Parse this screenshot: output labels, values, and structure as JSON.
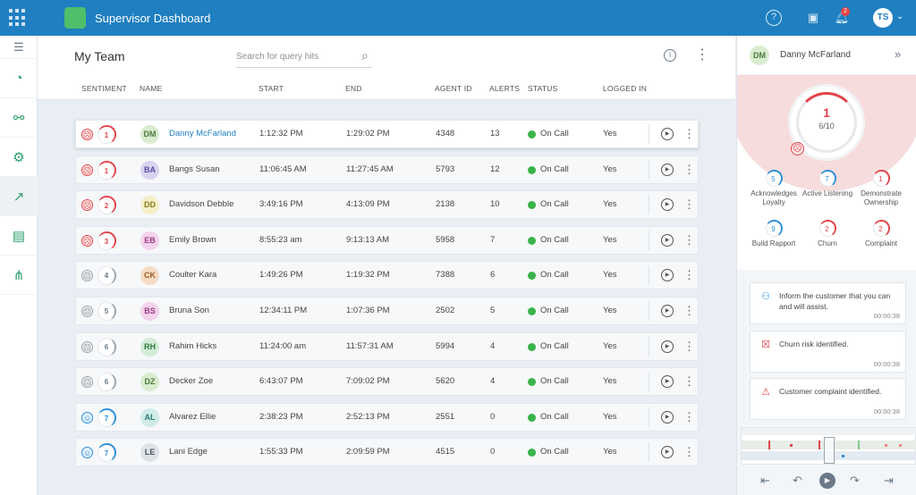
{
  "app": {
    "title": "Supervisor Dashboard",
    "notifications_count": "2",
    "user_initials": "TS",
    "icons": [
      "grid-icon",
      "help-icon",
      "screen-icon",
      "bell-icon",
      "chevron-down-icon"
    ]
  },
  "sidebar": {
    "items": [
      "menu-icon",
      "gauge-icon",
      "flow-icon",
      "gear-icon",
      "trend-icon",
      "list-icon",
      "share-icon"
    ],
    "active_index": 4
  },
  "panel": {
    "title": "My Team",
    "search_placeholder": "Search for query hits"
  },
  "columns": [
    "SENTIMENT",
    "NAME",
    "START",
    "END",
    "AGENT ID",
    "ALERTS",
    "STATUS",
    "LOGGED IN"
  ],
  "rows": [
    {
      "sentiment": "1",
      "tone": "neg",
      "initials": "DM",
      "av_bg": "#d9ecd0",
      "av_fg": "#4f7a3a",
      "name": "Danny McFarland",
      "start": "1:12:32 PM",
      "end": "1:29:02 PM",
      "agent_id": "4348",
      "alerts": "13",
      "status": "On Call",
      "logged_in": "Yes",
      "selected": true
    },
    {
      "sentiment": "1",
      "tone": "neg",
      "initials": "BA",
      "av_bg": "#d9d3f0",
      "av_fg": "#5b4aa0",
      "name": "Bangs Susan",
      "start": "11:06:45 AM",
      "end": "11:27:45 AM",
      "agent_id": "5793",
      "alerts": "12",
      "status": "On Call",
      "logged_in": "Yes"
    },
    {
      "sentiment": "2",
      "tone": "neg",
      "initials": "DD",
      "av_bg": "#f4efc8",
      "av_fg": "#8a7a1e",
      "name": "Davidson Debble",
      "start": "3:49:16 PM",
      "end": "4:13:09 PM",
      "agent_id": "2138",
      "alerts": "10",
      "status": "On Call",
      "logged_in": "Yes"
    },
    {
      "sentiment": "3",
      "tone": "neg",
      "initials": "EB",
      "av_bg": "#f3d3ec",
      "av_fg": "#9a3c86",
      "name": "Emily Brown",
      "start": "8:55:23 am",
      "end": "9:13:13 AM",
      "agent_id": "5958",
      "alerts": "7",
      "status": "On Call",
      "logged_in": "Yes"
    },
    {
      "sentiment": "4",
      "tone": "neu",
      "initials": "CK",
      "av_bg": "#f6dcc6",
      "av_fg": "#9a5a24",
      "name": "Coulter Kara",
      "start": "1:49:26 PM",
      "end": "1:19:32 PM",
      "agent_id": "7388",
      "alerts": "6",
      "status": "On Call",
      "logged_in": "Yes"
    },
    {
      "sentiment": "5",
      "tone": "neu",
      "initials": "BS",
      "av_bg": "#f3d3ec",
      "av_fg": "#9a3c86",
      "name": "Bruna Son",
      "start": "12:34:11 PM",
      "end": "1:07:36 PM",
      "agent_id": "2502",
      "alerts": "5",
      "status": "On Call",
      "logged_in": "Yes"
    },
    {
      "sentiment": "6",
      "tone": "neu",
      "initials": "RH",
      "av_bg": "#d3ecd6",
      "av_fg": "#2f7a3c",
      "name": "Rahim Hicks",
      "start": "11:24:00 am",
      "end": "11:57:31 AM",
      "agent_id": "5994",
      "alerts": "4",
      "status": "On Call",
      "logged_in": "Yes"
    },
    {
      "sentiment": "6",
      "tone": "neu",
      "initials": "DZ",
      "av_bg": "#d9ecd0",
      "av_fg": "#4f7a3a",
      "name": "Decker Zoe",
      "start": "6:43:07 PM",
      "end": "7:09:02 PM",
      "agent_id": "5620",
      "alerts": "4",
      "status": "On Call",
      "logged_in": "Yes"
    },
    {
      "sentiment": "7",
      "tone": "pos",
      "initials": "AL",
      "av_bg": "#d0ebe8",
      "av_fg": "#2a7a72",
      "name": "Alvarez Ellie",
      "start": "2:38:23 PM",
      "end": "2:52:13 PM",
      "agent_id": "2551",
      "alerts": "0",
      "status": "On Call",
      "logged_in": "Yes"
    },
    {
      "sentiment": "7",
      "tone": "pos",
      "initials": "LE",
      "av_bg": "#dfe3e8",
      "av_fg": "#4b5560",
      "name": "Lani Edge",
      "start": "1:55:33 PM",
      "end": "2:09:59 PM",
      "agent_id": "4515",
      "alerts": "0",
      "status": "On Call",
      "logged_in": "Yes"
    }
  ],
  "detail": {
    "initials": "DM",
    "name": "Danny McFarland",
    "score": "1",
    "score_sub": "6/10",
    "metrics": [
      {
        "value": "5",
        "label": "Acknowledges Loyalty",
        "tone": "blue"
      },
      {
        "value": "7",
        "label": "Active Listening",
        "tone": "blue"
      },
      {
        "value": "1",
        "label": "Demonstrate Ownership",
        "tone": "red"
      },
      {
        "value": "9",
        "label": "Build Rapport",
        "tone": "blue"
      },
      {
        "value": "2",
        "label": "Churn",
        "tone": "red"
      },
      {
        "value": "2",
        "label": "Complaint",
        "tone": "red"
      }
    ],
    "alerts": [
      {
        "icon": "agent-guidance-icon",
        "text": "Inform the customer that you can and will assist.",
        "time": "00:00:38",
        "color": "#2e8fd6"
      },
      {
        "icon": "churn-risk-icon",
        "text": "Churn risk identified.",
        "time": "00:00:38",
        "color": "#e0454b"
      },
      {
        "icon": "complaint-icon",
        "text": "Customer complaint identified.",
        "time": "00:00:38",
        "color": "#e0454b"
      }
    ],
    "controls": [
      "skip-back-icon",
      "rewind-icon",
      "play-icon",
      "forward-icon",
      "skip-forward-icon"
    ]
  },
  "colors": {
    "brand": "#1f7fc0",
    "negative": "#e0454b",
    "positive": "#2e8fd6",
    "on_call": "#3ab34a"
  }
}
